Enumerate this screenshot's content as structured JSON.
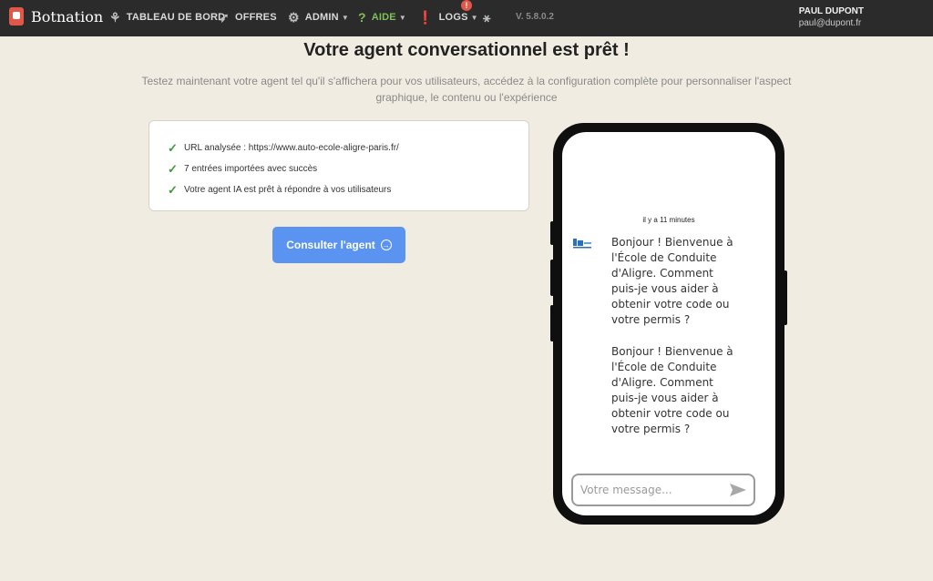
{
  "nav": {
    "brand": "Botnation",
    "items": [
      {
        "label": "TABLEAU DE BORD",
        "icon": "dashboard-icon"
      },
      {
        "label": "OFFRES",
        "icon": "rocket-icon"
      },
      {
        "label": "ADMIN",
        "icon": "gear-icon"
      },
      {
        "label": "AIDE",
        "icon": "question-icon"
      },
      {
        "label": "LOGS",
        "icon": "alert-icon"
      }
    ],
    "logs_badge": "!",
    "version": "V. 5.8.0.2",
    "user_name": "PAUL DUPONT",
    "user_email": "paul@dupont.fr"
  },
  "main": {
    "title": "Votre agent conversationnel est prêt !",
    "subtitle": "Testez maintenant votre agent tel qu'il s'affichera pour vos utilisateurs, accédez à la configuration complète pour personnaliser l'aspect graphique, le contenu ou l'expérience",
    "checks": [
      "URL analysée : https://www.auto-ecole-aligre-paris.fr/",
      "7 entrées importées avec succès",
      "Votre agent IA est prêt à répondre à vos utilisateurs"
    ],
    "cta_label": "Consulter l'agent"
  },
  "chat": {
    "timestamp": "il y a 11 minutes",
    "messages": [
      "Bonjour ! Bienvenue à l'École de Conduite d'Aligre. Comment puis-je vous aider à obtenir votre code ou votre permis ?",
      "Bonjour ! Bienvenue à l'École de Conduite d'Aligre. Comment puis-je vous aider à obtenir votre code ou votre permis ?"
    ],
    "input_placeholder": "Votre message..."
  },
  "colors": {
    "nav_bg": "#2b2b2b",
    "page_bg": "#f1ece1",
    "accent": "#5b94f0",
    "check": "#3e9a3a",
    "brand": "#e0584a"
  }
}
